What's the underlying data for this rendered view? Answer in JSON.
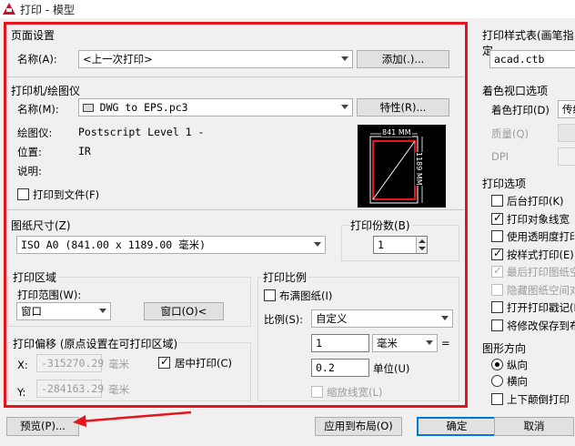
{
  "window": {
    "title": "打印 - 模型"
  },
  "page_setup": {
    "section_title": "页面设置",
    "name_label": "名称(A):",
    "name_value": "<上一次打印>",
    "add_button": "添加(.)..."
  },
  "printer": {
    "section_title": "打印机/绘图仪",
    "name_label": "名称(M):",
    "name_value": "DWG to EPS.pc3",
    "properties_button": "特性(R)...",
    "plotter_label": "绘图仪:",
    "plotter_value": "Postscript Level 1 -",
    "location_label": "位置:",
    "location_value": "IR",
    "description_label": "说明:",
    "print_to_file_label": "打印到文件(F)",
    "print_to_file_checked": false,
    "preview_width_label": "841 MM",
    "preview_height_label": "1189 MM"
  },
  "paper_size": {
    "section_title": "图纸尺寸(Z)",
    "value": "ISO A0 (841.00 x 1189.00 毫米)"
  },
  "copies": {
    "section_title": "打印份数(B)",
    "value": "1"
  },
  "plot_area": {
    "section_title": "打印区域",
    "range_label": "打印范围(W):",
    "range_value": "窗口",
    "window_button": "窗口(O)<"
  },
  "plot_scale": {
    "section_title": "打印比例",
    "fit_paper_label": "布满图纸(I)",
    "fit_paper_checked": false,
    "scale_label": "比例(S):",
    "scale_value": "自定义",
    "value1": "1",
    "unit_value": "毫米",
    "equals": "=",
    "value2": "0.2",
    "unit_label": "单位(U)",
    "scale_lineweights_label": "缩放线宽(L)",
    "scale_lineweights_checked": false
  },
  "plot_offset": {
    "section_title": "打印偏移 (原点设置在可打印区域)",
    "x_label": "X:",
    "x_value": "-315270.29",
    "x_unit": "毫米",
    "y_label": "Y:",
    "y_value": "-284163.29",
    "y_unit": "毫米",
    "center_label": "居中打印(C)",
    "center_checked": true
  },
  "plot_style_table": {
    "section_title": "打印样式表(画笔指定",
    "value": "acad.ctb"
  },
  "shaded_viewport": {
    "section_title": "着色视口选项",
    "shade_plot_label": "着色打印(D)",
    "shade_plot_value": "传统",
    "quality_label": "质量(Q)",
    "dpi_label": "DPI"
  },
  "plot_options": {
    "section_title": "打印选项",
    "items": [
      {
        "label": "后台打印(K)",
        "checked": false,
        "disabled": false
      },
      {
        "label": "打印对象线宽",
        "checked": true,
        "disabled": false
      },
      {
        "label": "使用透明度打印",
        "checked": false,
        "disabled": false
      },
      {
        "label": "按样式打印(E)",
        "checked": true,
        "disabled": false
      },
      {
        "label": "最后打印图纸空",
        "checked": true,
        "disabled": true
      },
      {
        "label": "隐藏图纸空间对",
        "checked": false,
        "disabled": true
      },
      {
        "label": "打开打印戳记(N",
        "checked": false,
        "disabled": false
      },
      {
        "label": "将修改保存到布",
        "checked": false,
        "disabled": false
      }
    ]
  },
  "orientation": {
    "section_title": "图形方向",
    "portrait_label": "纵向",
    "landscape_label": "横向",
    "selected": "portrait",
    "upside_down_label": "上下颠倒打印"
  },
  "footer": {
    "preview_button": "预览(P)...",
    "apply_button": "应用到布局(O)",
    "ok_button": "确定",
    "cancel_button": "取消"
  },
  "colors": {
    "highlight": "#e8141c",
    "primary_border": "#0078d7"
  }
}
